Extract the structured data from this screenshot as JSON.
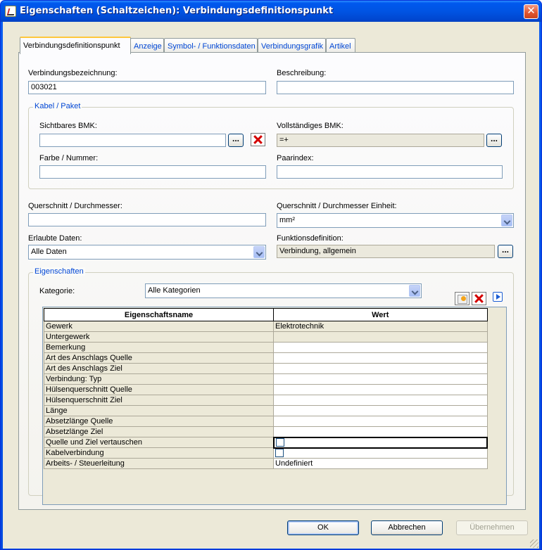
{
  "window": {
    "title": "Eigenschaften (Schaltzeichen): Verbindungsdefinitionspunkt",
    "close": "✕"
  },
  "tabs": [
    {
      "label": "Verbindungsdefinitionspunkt",
      "active": true
    },
    {
      "label": "Anzeige"
    },
    {
      "label": "Symbol- / Funktionsdaten"
    },
    {
      "label": "Verbindungsgrafik"
    },
    {
      "label": "Artikel"
    }
  ],
  "fields": {
    "verbindungsbezeichnung_label": "Verbindungsbezeichnung:",
    "verbindungsbezeichnung_value": "003021",
    "beschreibung_label": "Beschreibung:",
    "beschreibung_value": "",
    "querschnitt_label": "Querschnitt / Durchmesser:",
    "querschnitt_value": "",
    "querschnitt_einheit_label": "Querschnitt / Durchmesser Einheit:",
    "querschnitt_einheit_value": "mm²",
    "erlaubte_daten_label": "Erlaubte Daten:",
    "erlaubte_daten_value": "Alle Daten",
    "funktionsdefinition_label": "Funktionsdefinition:",
    "funktionsdefinition_value": "Verbindung, allgemein"
  },
  "kabel": {
    "legend": "Kabel / Paket",
    "sichtbares_bmk_label": "Sichtbares BMK:",
    "sichtbares_bmk_value": "",
    "vollstaendiges_bmk_label": "Vollständiges BMK:",
    "vollstaendiges_bmk_value": "=+",
    "farbe_label": "Farbe / Nummer:",
    "farbe_value": "",
    "paarindex_label": "Paarindex:",
    "paarindex_value": "",
    "dots": "..."
  },
  "eigenschaften": {
    "legend": "Eigenschaften",
    "kategorie_label": "Kategorie:",
    "kategorie_value": "Alle Kategorien",
    "columns": [
      "Eigenschaftsname",
      "Wert"
    ],
    "rows": [
      {
        "name": "Gewerk",
        "value": "Elektrotechnik",
        "readonly": true
      },
      {
        "name": "Untergewerk",
        "value": "",
        "readonly": true
      },
      {
        "name": "Bemerkung",
        "value": ""
      },
      {
        "name": "Art des Anschlags Quelle",
        "value": ""
      },
      {
        "name": "Art des Anschlags Ziel",
        "value": ""
      },
      {
        "name": "Verbindung: Typ",
        "value": ""
      },
      {
        "name": "Hülsenquerschnitt Quelle",
        "value": ""
      },
      {
        "name": "Hülsenquerschnitt Ziel",
        "value": ""
      },
      {
        "name": "Länge",
        "value": ""
      },
      {
        "name": "Absetzlänge Quelle",
        "value": ""
      },
      {
        "name": "Absetzlänge Ziel",
        "value": ""
      },
      {
        "name": "Quelle und Ziel vertauschen",
        "value": "",
        "checkbox": true,
        "focused": true
      },
      {
        "name": "Kabelverbindung",
        "value": "",
        "checkbox": true
      },
      {
        "name": "Arbeits- / Steuerleitung",
        "value": "Undefiniert"
      }
    ]
  },
  "buttons": {
    "ok": "OK",
    "abbrechen": "Abbrechen",
    "uebernehmen": "Übernehmen"
  }
}
